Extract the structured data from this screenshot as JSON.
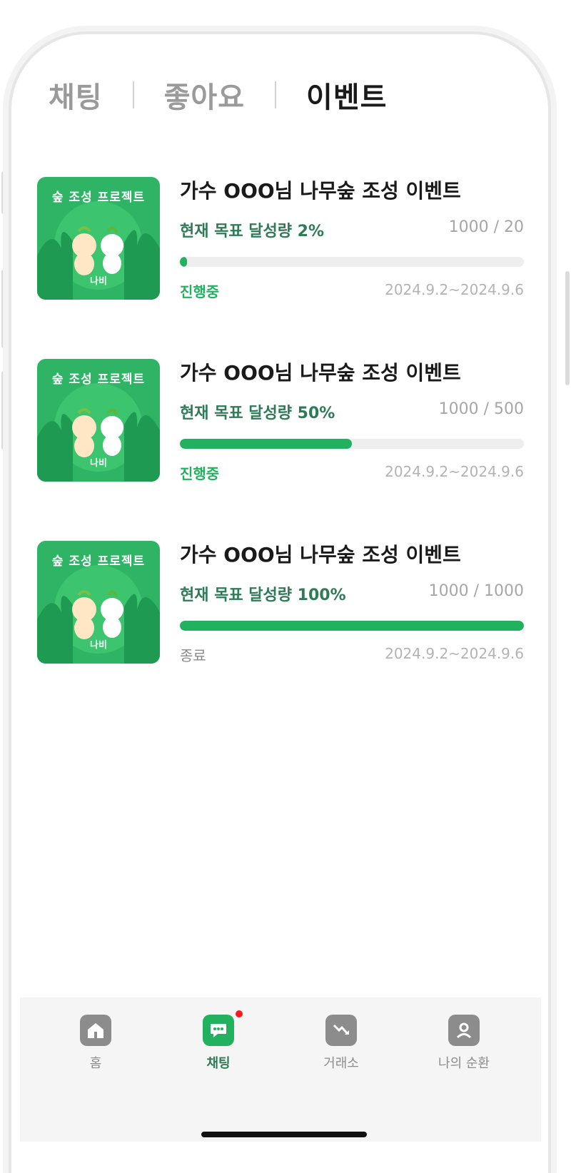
{
  "tabs": [
    {
      "label": "채팅",
      "active": false
    },
    {
      "label": "좋아요",
      "active": false
    },
    {
      "label": "이벤트",
      "active": true
    }
  ],
  "events": [
    {
      "title": "가수 OOO님 나무숲 조성 이벤트",
      "progress_label": "현재 목표 달성량 2%",
      "progress_percent": 2,
      "count": "1000 / 20",
      "status": "진행중",
      "status_kind": "active",
      "date": "2024.9.2~2024.9.6",
      "thumb_title": "숲 조성 프로젝트",
      "thumb_logo": "나비"
    },
    {
      "title": "가수 OOO님 나무숲 조성 이벤트",
      "progress_label": "현재 목표 달성량 50%",
      "progress_percent": 50,
      "count": "1000 / 500",
      "status": "진행중",
      "status_kind": "active",
      "date": "2024.9.2~2024.9.6",
      "thumb_title": "숲 조성 프로젝트",
      "thumb_logo": "나비"
    },
    {
      "title": "가수 OOO님 나무숲 조성 이벤트",
      "progress_label": "현재 목표 달성량 100%",
      "progress_percent": 100,
      "count": "1000 / 1000",
      "status": "종료",
      "status_kind": "ended",
      "date": "2024.9.2~2024.9.6",
      "thumb_title": "숲 조성 프로젝트",
      "thumb_logo": "나비"
    }
  ],
  "nav": [
    {
      "label": "홈",
      "icon": "home-icon",
      "active": false
    },
    {
      "label": "채팅",
      "icon": "chat-icon",
      "active": true,
      "has_badge": true
    },
    {
      "label": "거래소",
      "icon": "trend-down-icon",
      "active": false
    },
    {
      "label": "나의 순환",
      "icon": "profile-icon",
      "active": false
    }
  ],
  "colors": {
    "accent": "#22b15e",
    "accent_text": "#2f7a57",
    "badge": "#ff1a1a"
  }
}
